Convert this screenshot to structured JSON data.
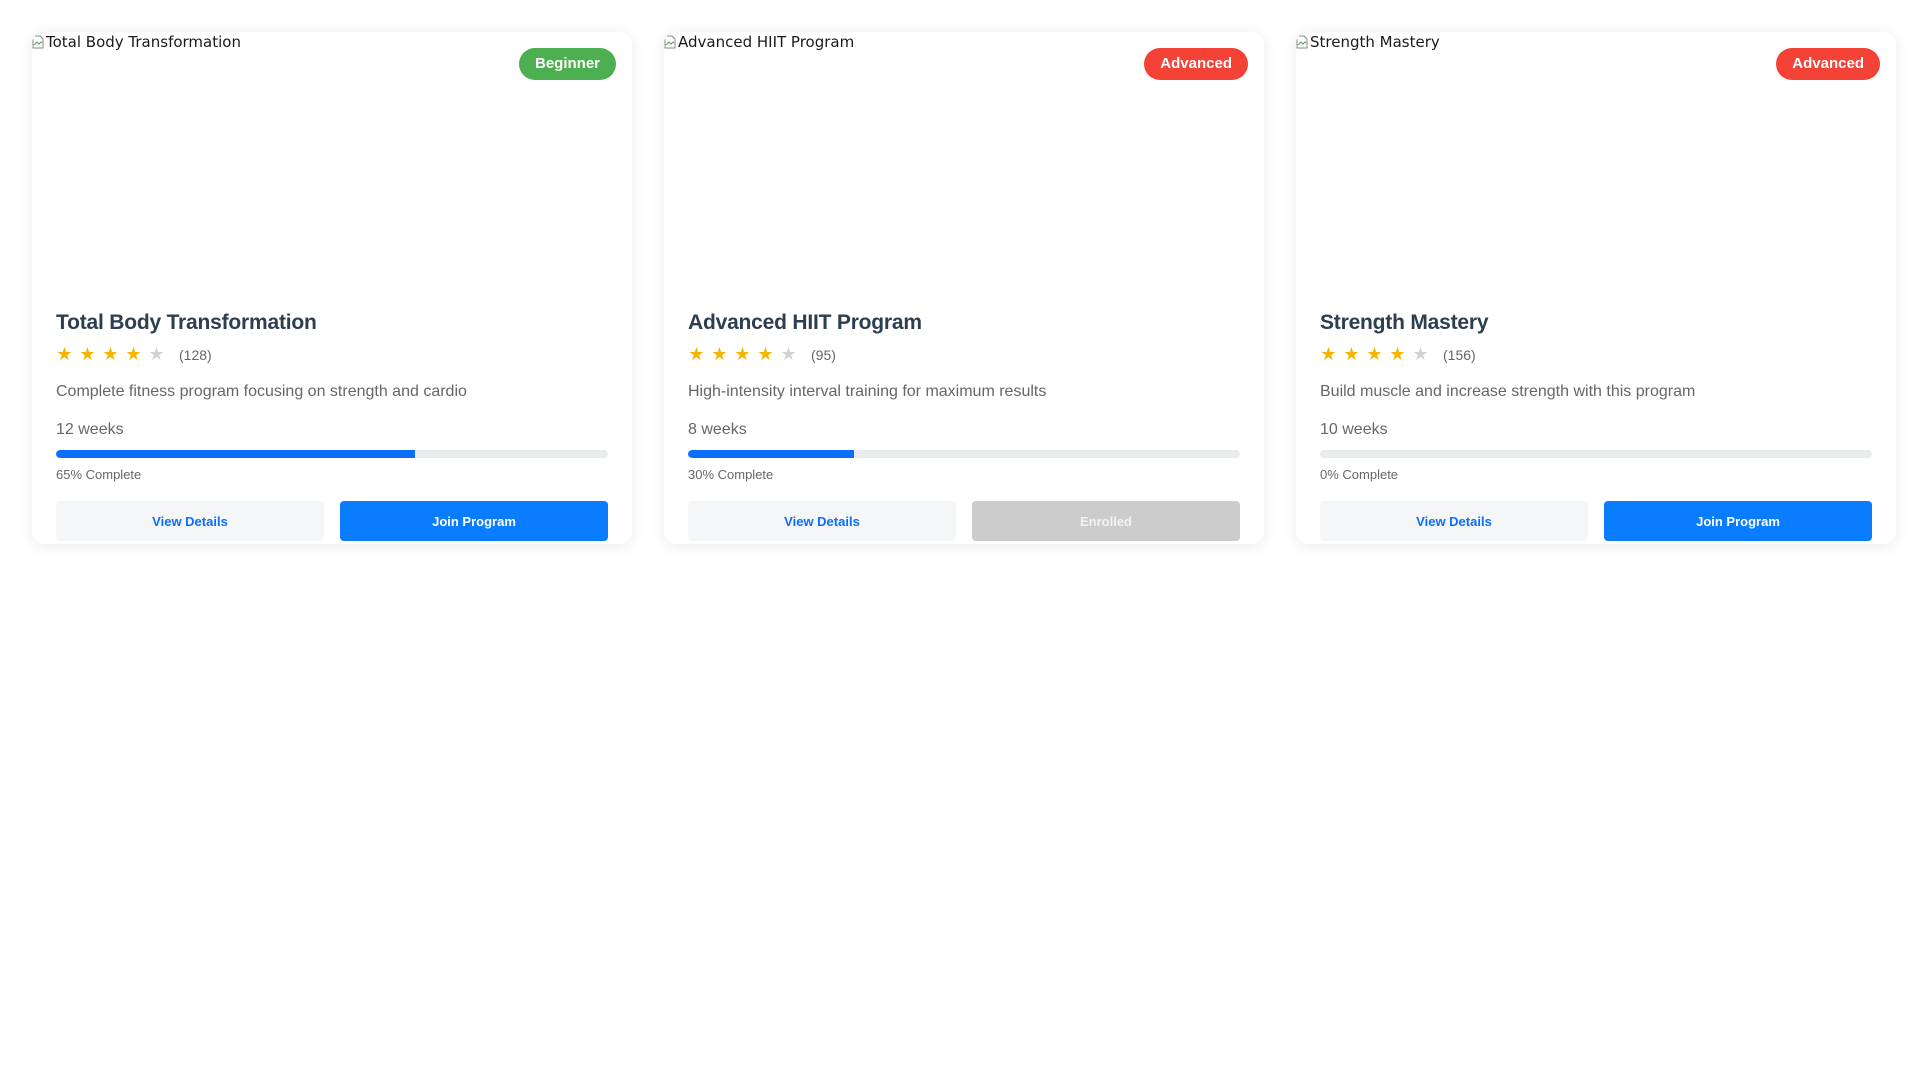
{
  "programs": [
    {
      "image_alt": "Total Body Transformation",
      "level": "Beginner",
      "level_color": "#4caf50",
      "title": "Total Body Transformation",
      "rating": 4,
      "rating_max": 5,
      "reviews": "(128)",
      "description": "Complete fitness program focusing on strength and cardio",
      "duration": "12 weeks",
      "progress_percent": 65,
      "progress_label": "65% Complete",
      "details_label": "View Details",
      "action_label": "Join Program",
      "action_state": "join"
    },
    {
      "image_alt": "Advanced HIIT Program",
      "level": "Advanced",
      "level_color": "#f44336",
      "title": "Advanced HIIT Program",
      "rating": 4,
      "rating_max": 5,
      "reviews": "(95)",
      "description": "High-intensity interval training for maximum results",
      "duration": "8 weeks",
      "progress_percent": 30,
      "progress_label": "30% Complete",
      "details_label": "View Details",
      "action_label": "Enrolled",
      "action_state": "enrolled"
    },
    {
      "image_alt": "Strength Mastery",
      "level": "Advanced",
      "level_color": "#f44336",
      "title": "Strength Mastery",
      "rating": 4,
      "rating_max": 5,
      "reviews": "(156)",
      "description": "Build muscle and increase strength with this program",
      "duration": "10 weeks",
      "progress_percent": 0,
      "progress_label": "0% Complete",
      "details_label": "View Details",
      "action_label": "Join Program",
      "action_state": "join"
    }
  ],
  "colors": {
    "star_on": "#f6b400",
    "star_off": "#d3d3d3",
    "progress_fill": "#0d6efd",
    "primary_button": "#0a7cff",
    "disabled_button": "#cccccc"
  },
  "icons": {
    "broken_image": "broken-image-icon",
    "star": "star-icon"
  }
}
